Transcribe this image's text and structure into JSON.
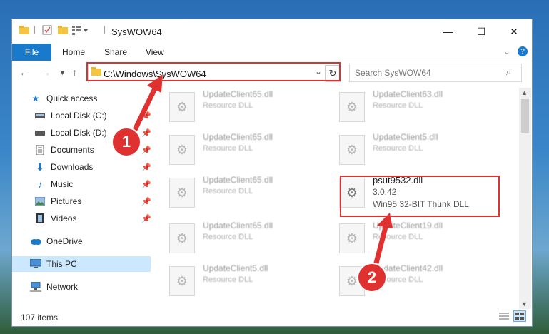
{
  "window": {
    "title": "SysWOW64"
  },
  "window_controls": {
    "minimize": "—",
    "maximize": "☐",
    "close": "✕"
  },
  "ribbon": {
    "file": "File",
    "home": "Home",
    "share": "Share",
    "view": "View"
  },
  "address": {
    "path": "C:\\Windows\\SysWOW64"
  },
  "search": {
    "placeholder": "Search SysWOW64"
  },
  "sidebar": {
    "items": [
      {
        "label": "Quick access"
      },
      {
        "label": "Local Disk (C:)"
      },
      {
        "label": "Local Disk (D:)"
      },
      {
        "label": "Documents"
      },
      {
        "label": "Downloads"
      },
      {
        "label": "Music"
      },
      {
        "label": "Pictures"
      },
      {
        "label": "Videos"
      },
      {
        "label": "OneDrive"
      },
      {
        "label": "This PC"
      },
      {
        "label": "Network"
      }
    ]
  },
  "files": [
    {
      "name": "UpdateClient65.dll",
      "desc": "Resource DLL"
    },
    {
      "name": "UpdateClient63.dll",
      "desc": "Resource DLL"
    },
    {
      "name": "UpdateClient65.dll",
      "desc": "Resource DLL"
    },
    {
      "name": "UpdateClient5.dll",
      "desc": "Resource DLL"
    },
    {
      "name": "UpdateClient65.dll",
      "desc": "Resource DLL"
    },
    {
      "name": "psut9532.dll",
      "desc": "3.0.42",
      "desc2": "Win95 32-BIT Thunk DLL"
    },
    {
      "name": "UpdateClient65.dll",
      "desc": "Resource DLL"
    },
    {
      "name": "UpdateClient19.dll",
      "desc": "Resource DLL"
    },
    {
      "name": "UpdateClient5.dll",
      "desc": "Resource DLL"
    },
    {
      "name": "UpdateClient42.dll",
      "desc": "Resource DLL"
    }
  ],
  "status": {
    "count": "107 items"
  },
  "callouts": {
    "one": "1",
    "two": "2"
  },
  "colors": {
    "accent": "#1979ca",
    "highlight": "#e03131",
    "selection": "#cce8ff"
  }
}
